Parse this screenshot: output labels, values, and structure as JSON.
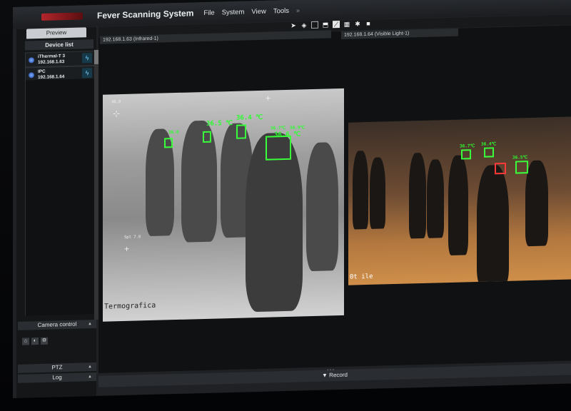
{
  "app": {
    "title": "Fever Scanning System",
    "menu": [
      "File",
      "System",
      "View",
      "Tools"
    ]
  },
  "left_panel": {
    "tab_preview": "Preview",
    "device_list_title": "Device list",
    "devices": [
      {
        "name": "iThermal-T 3",
        "ip": "192.168.1.63"
      },
      {
        "name": "IPC",
        "ip": "192.168.1.64"
      }
    ],
    "camera_control": "Camera control",
    "ptz": "PTZ",
    "log": "Log"
  },
  "cameras": {
    "infrared_label": "192.168.1.63 (Infrared-1)",
    "visible_label": "192.168.1.64 (Visible Light-1)"
  },
  "thermal_overlay": {
    "watermark": "Termografica",
    "temps": [
      "36.0",
      "36.5 ℃",
      "36.4 ℃",
      "36.6 ℃",
      "36.7℃",
      "36.9℃"
    ],
    "hud_value": "40.0",
    "spot_label": "Spt 7.0"
  },
  "visible_overlay": {
    "temps": [
      "36.7℃",
      "36.4℃",
      "36.5℃"
    ],
    "timestamp": "0t ile"
  },
  "footer": {
    "record": "Record"
  },
  "colors": {
    "accent_green": "#39ff3a",
    "alert_red": "#ff3939",
    "logo_red": "#b3262b"
  }
}
